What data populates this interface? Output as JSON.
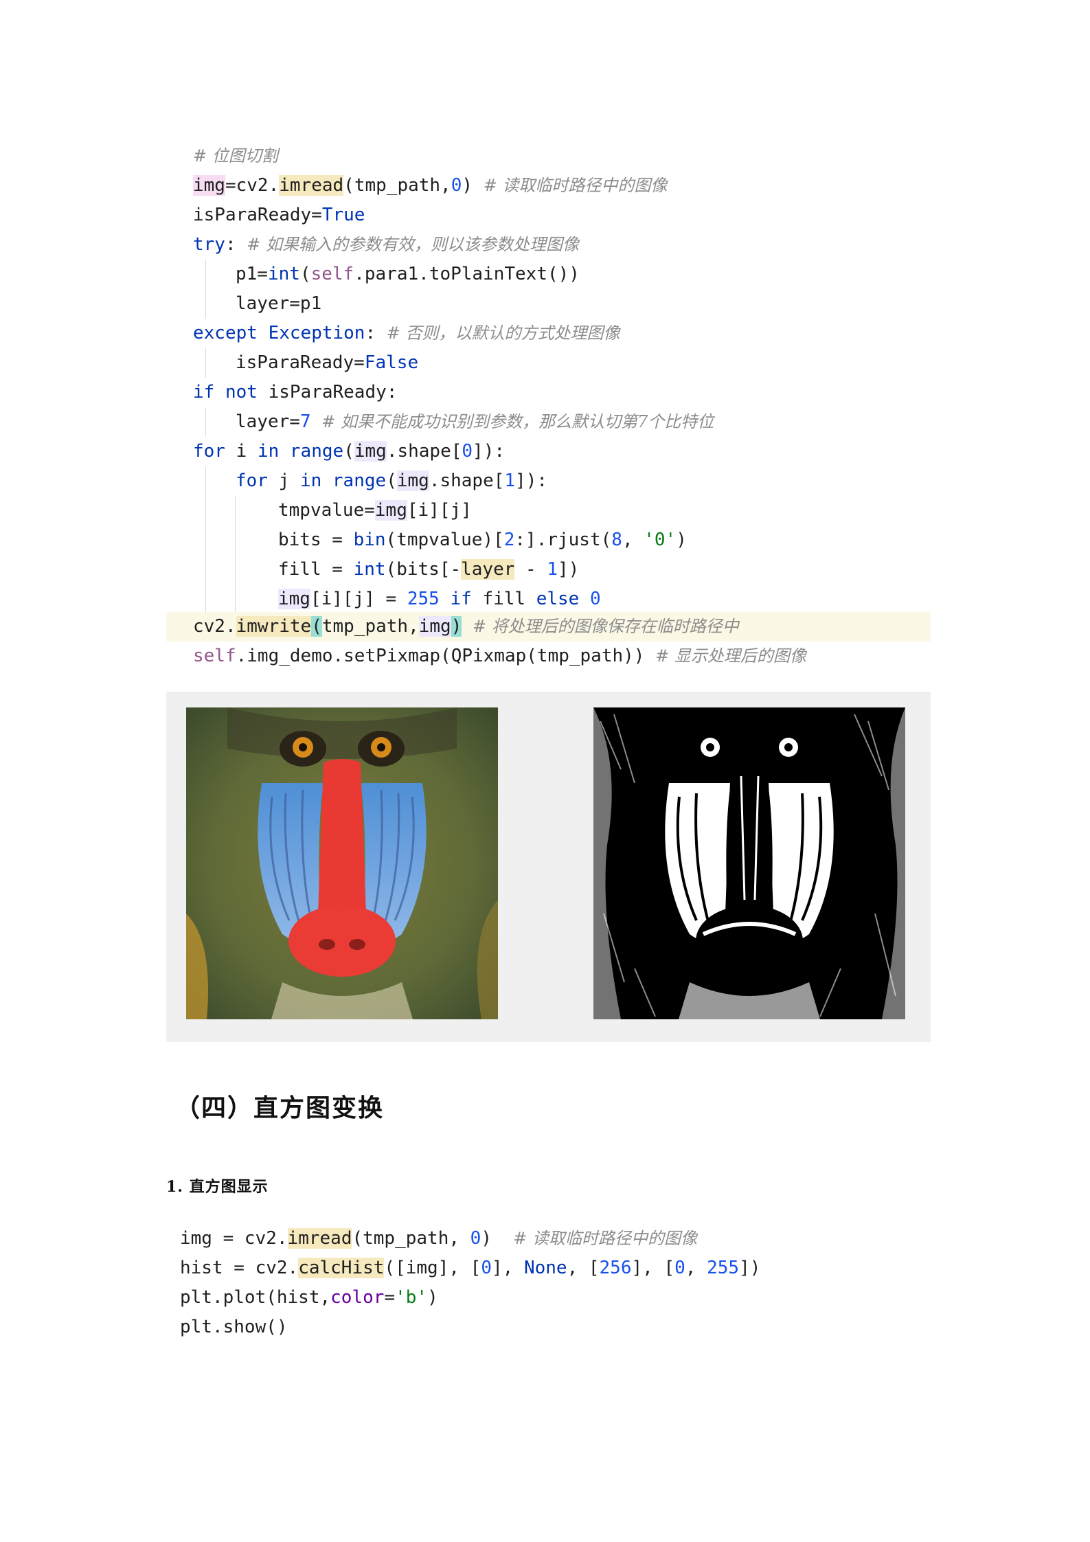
{
  "code1": {
    "lines": [
      "# 位图切割",
      "img=cv2.imread(tmp_path,0) # 读取临时路径中的图像",
      "isParaReady=True",
      "try: # 如果输入的参数有效，则以该参数处理图像",
      "p1=int(self.para1.toPlainText())",
      "layer=p1",
      "except Exception: # 否则，以默认的方式处理图像",
      "isParaReady=False",
      "if not isParaReady:",
      "layer=7 # 如果不能成功识别到参数，那么默认切第7个比特位",
      "for i in range(img.shape[0]):",
      "for j in range(img.shape[1]):",
      "tmpvalue=img[i][j]",
      "bits = bin(tmpvalue)[2:].rjust(8, '0')",
      "fill = int(bits[-layer - 1])",
      "img[i][j] = 255 if fill else 0",
      "cv2.imwrite(tmp_path,img) # 将处理后的图像保存在临时路径中",
      "self.img_demo.setPixmap(QPixmap(tmp_path)) # 显示处理后的图像"
    ]
  },
  "images": {
    "left_icon": "mandrill-color-image",
    "right_icon": "mandrill-bitplane-image"
  },
  "heading": "（四）直方图变换",
  "subheading": "1. 直方图显示",
  "code2": {
    "lines": [
      "img = cv2.imread(tmp_path, 0)  # 读取临时路径中的图像",
      "hist = cv2.calcHist([img], [0], None, [256], [0, 255])",
      "plt.plot(hist,color='b')",
      "plt.show()"
    ]
  }
}
